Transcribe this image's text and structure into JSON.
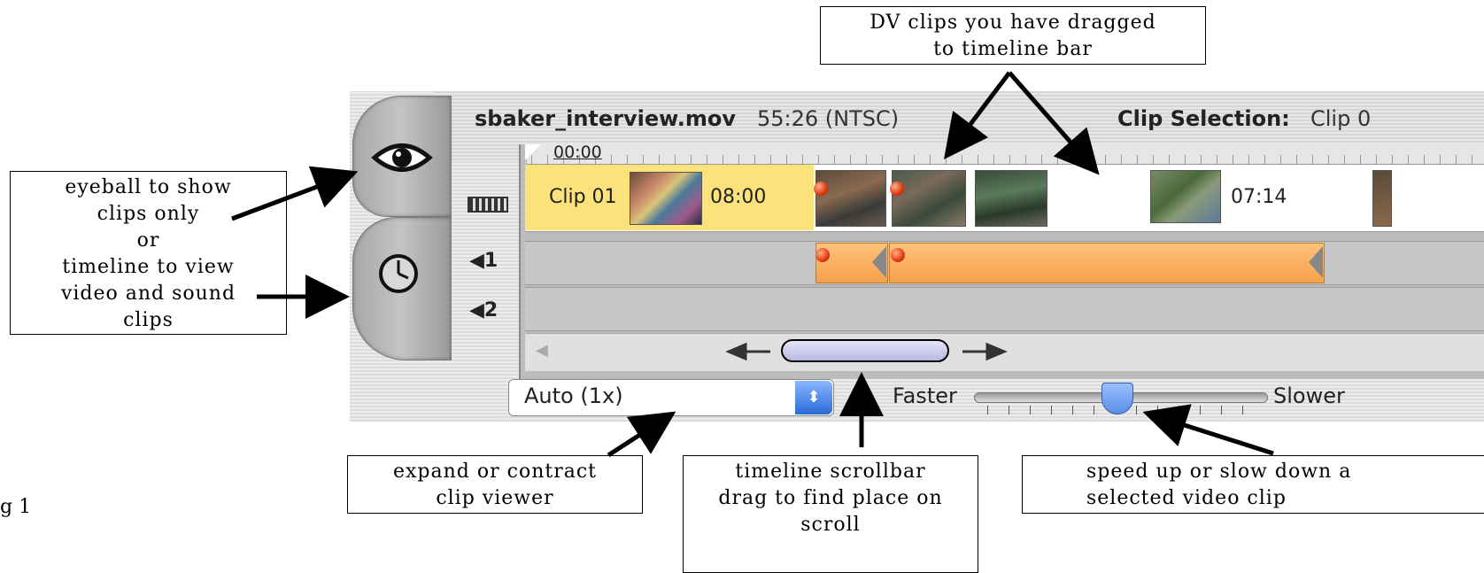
{
  "window": {
    "filename": "sbaker_interview.mov",
    "duration": "55:26 (NTSC)",
    "clip_selection_label": "Clip Selection:",
    "clip_selection_value": "Clip 0"
  },
  "timeline": {
    "ruler_time": "00:00",
    "clips": [
      {
        "label": "Clip 01",
        "time": "08:00",
        "selected": true
      },
      {
        "label": "",
        "time": "07:14",
        "selected": false
      }
    ],
    "audio_tracks": [
      "1",
      "2"
    ]
  },
  "controls": {
    "zoom_select_value": "Auto (1x)",
    "faster_label": "Faster",
    "slower_label": "Slower"
  },
  "callouts": {
    "dv_clips": "DV clips you have dragged\nto timeline bar",
    "eyeball": "eyeball to show\nclips only\nor\ntimeline to view\nvideo and sound\nclips",
    "expand": "expand or contract\nclip viewer",
    "scrollbar": "timeline scrollbar\ndrag to find place on\nscroll",
    "speed": "speed up or slow down a\nselected video clip"
  },
  "figure_label": "g 1",
  "icons": {
    "eye_tab": "eye-icon",
    "clock_tab": "clock-icon",
    "video_track": "film-strip-icon",
    "audio_track": "speaker-icon",
    "zoom_select": "up-down-arrows-icon"
  },
  "colors": {
    "selected_clip": "#fbe27a",
    "audio_clip": "#f6a14a",
    "scroll_thumb": "#b8b8e4",
    "slider_knob": "#5a8ee8"
  }
}
